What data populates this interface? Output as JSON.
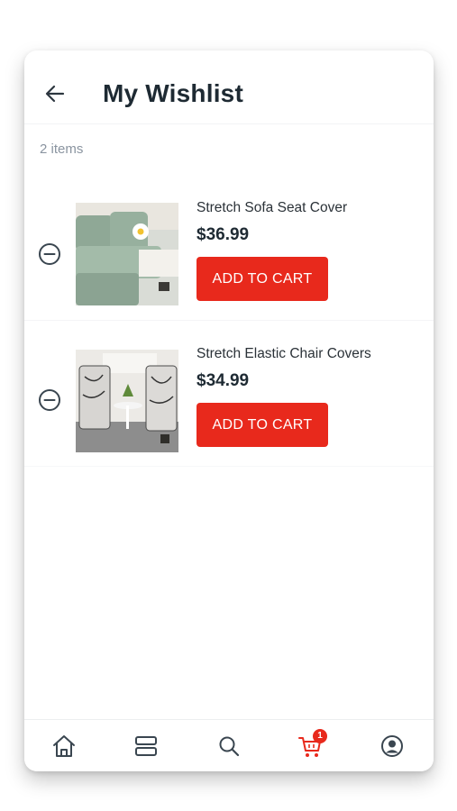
{
  "header": {
    "title": "My Wishlist",
    "back_icon": "arrow-left-icon"
  },
  "summary": {
    "count_text": "2 items"
  },
  "items": [
    {
      "name": "Stretch Sofa Seat Cover",
      "price": "$36.99",
      "button_label": "ADD TO CART",
      "image": "sofa-seat-cover-photo"
    },
    {
      "name": "Stretch Elastic Chair Covers",
      "price": "$34.99",
      "button_label": "ADD TO CART",
      "image": "chair-covers-photo"
    }
  ],
  "nav": {
    "items": [
      {
        "icon": "home-icon"
      },
      {
        "icon": "categories-icon"
      },
      {
        "icon": "search-icon"
      },
      {
        "icon": "cart-icon",
        "badge": "1"
      },
      {
        "icon": "account-icon"
      }
    ]
  },
  "colors": {
    "accent": "#e8291c",
    "text": "#1e2a33",
    "muted": "#8a94a0"
  }
}
